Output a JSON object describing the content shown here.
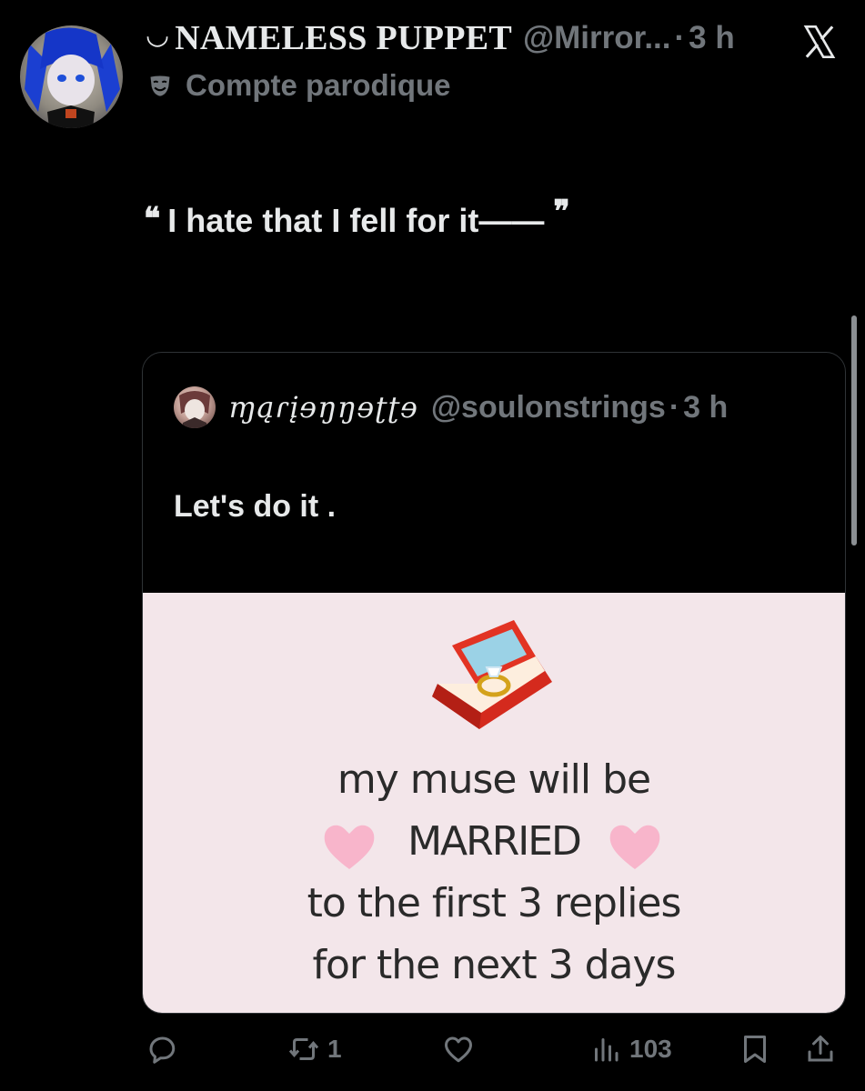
{
  "author": {
    "name_prefix": "◡",
    "display_name": "NAMELESS PUPPET",
    "handle": "@Mirror...",
    "separator": "·",
    "time": "3 h",
    "badge_label": "Compte parodique"
  },
  "post": {
    "open_quote": "❝",
    "text": "I hate that I fell for it——",
    "close_quote": "❞"
  },
  "quoted": {
    "display_name": "ɱąɾįɘŋŋɘʈʈɘ",
    "handle": "@soulonstrings",
    "separator": "·",
    "time": "3 h",
    "text": "Let's do it .",
    "image_text": {
      "line1": "my muse will be",
      "line2": "MARRIED",
      "line3": "to the first 3 replies",
      "line4": "for the next 3 days"
    }
  },
  "actions": {
    "reply_count": "",
    "repost_count": "1",
    "like_count": "",
    "views_count": "103"
  },
  "icons": [
    "x-logo-icon",
    "parody-mask-icon",
    "reply-icon",
    "repost-icon",
    "like-icon",
    "views-icon",
    "bookmark-icon",
    "share-icon",
    "ring-box-icon",
    "heart-icon"
  ],
  "colors": {
    "background": "#000000",
    "text_primary": "#e7e9ea",
    "text_secondary": "#71767b",
    "border": "#2f3336",
    "meme_background": "#f3e6ea"
  }
}
